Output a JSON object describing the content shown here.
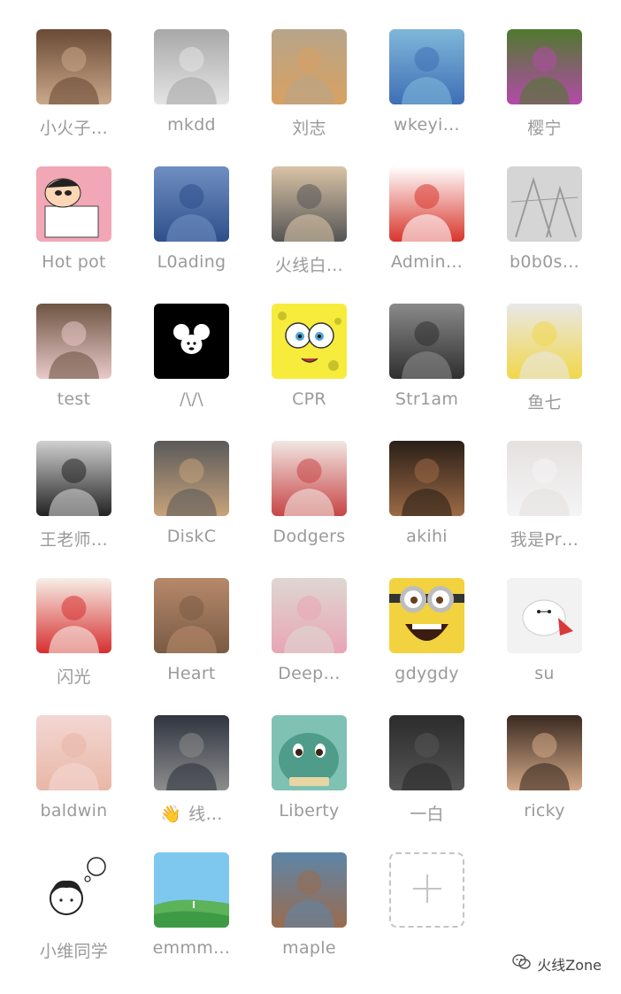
{
  "members": [
    {
      "name": "小火子…",
      "avatar_icon": "man-portrait-icon",
      "colors": [
        "#6b4a36",
        "#c9a88a"
      ]
    },
    {
      "name": "mkdd",
      "avatar_icon": "cat-toy-icon",
      "colors": [
        "#a8a8a8",
        "#e4e4e4"
      ]
    },
    {
      "name": "刘志",
      "avatar_icon": "shiba-dog-icon",
      "colors": [
        "#b7a58a",
        "#d8a162"
      ]
    },
    {
      "name": "wkeyi…",
      "avatar_icon": "stitch-cartoon-icon",
      "colors": [
        "#7fb7d9",
        "#3f6fb6"
      ]
    },
    {
      "name": "樱宁",
      "avatar_icon": "teletubby-icon",
      "colors": [
        "#4f7a2e",
        "#b34aa8"
      ]
    },
    {
      "name": "Hot pot",
      "avatar_icon": "crayon-shin-chan-icon",
      "colors": [
        "#f2a7b6",
        "#ffffff"
      ]
    },
    {
      "name": "L0ading",
      "avatar_icon": "cloaked-figure-icon",
      "colors": [
        "#6f8fc3",
        "#2e4f8a"
      ]
    },
    {
      "name": "火线白…",
      "avatar_icon": "kitten-laptop-icon",
      "colors": [
        "#d9c3a6",
        "#555555"
      ]
    },
    {
      "name": "Admin…",
      "avatar_icon": "masked-man-icon",
      "colors": [
        "#ffffff",
        "#d8352b"
      ]
    },
    {
      "name": "b0b0s…",
      "avatar_icon": "sketch-drawing-icon",
      "colors": [
        "#d5d5d5",
        "#9a9a9a"
      ]
    },
    {
      "name": "test",
      "avatar_icon": "bunny-ears-person-icon",
      "colors": [
        "#6e5543",
        "#e9c9c9"
      ]
    },
    {
      "name": "/\\/\\",
      "avatar_icon": "mickey-mouse-icon",
      "colors": [
        "#000000",
        "#ffffff"
      ]
    },
    {
      "name": "CPR",
      "avatar_icon": "spongebob-icon",
      "colors": [
        "#f7ec3c",
        "#e0a23a"
      ]
    },
    {
      "name": "Str1am",
      "avatar_icon": "two-people-photo-icon",
      "colors": [
        "#8a8a8a",
        "#2f2f2f"
      ]
    },
    {
      "name": "鱼七",
      "avatar_icon": "two-kids-snow-icon",
      "colors": [
        "#e8e8e8",
        "#f2d74a"
      ]
    },
    {
      "name": "王老师…",
      "avatar_icon": "boy-okc-shirt-icon",
      "colors": [
        "#d0d0d0",
        "#222222"
      ]
    },
    {
      "name": "DiskC",
      "avatar_icon": "cat-in-bowl-icon",
      "colors": [
        "#5a5a5a",
        "#c7a37a"
      ]
    },
    {
      "name": "Dodgers",
      "avatar_icon": "woman-red-book-icon",
      "colors": [
        "#f1e7e3",
        "#c74545"
      ]
    },
    {
      "name": "akihi",
      "avatar_icon": "curly-hair-person-icon",
      "colors": [
        "#2a1f18",
        "#9c6a45"
      ]
    },
    {
      "name": "我是Pr…",
      "avatar_icon": "white-cat-icon",
      "colors": [
        "#e6e1e1",
        "#f4f4f4"
      ]
    },
    {
      "name": "闪光",
      "avatar_icon": "anime-boy-flag-icon",
      "colors": [
        "#f7efe7",
        "#d62f2f"
      ]
    },
    {
      "name": "Heart",
      "avatar_icon": "tabby-cat-icon",
      "colors": [
        "#b6896a",
        "#7a5b44"
      ]
    },
    {
      "name": "Deep…",
      "avatar_icon": "little-girl-icon",
      "colors": [
        "#ded7d2",
        "#e9a5b5"
      ]
    },
    {
      "name": "gdygdy",
      "avatar_icon": "minion-icon",
      "colors": [
        "#f2d23e",
        "#6f6f6f"
      ]
    },
    {
      "name": "su",
      "avatar_icon": "baymax-icon",
      "colors": [
        "#f2f2f2",
        "#d83a3a"
      ]
    },
    {
      "name": "baldwin",
      "avatar_icon": "baby-bunny-hat-icon",
      "colors": [
        "#f3d7d3",
        "#e8b7a6"
      ]
    },
    {
      "name": "线…",
      "avatar_icon": "night-street-icon",
      "colors": [
        "#2f3440",
        "#8d8d8d"
      ],
      "prefix_emoji": "👋"
    },
    {
      "name": "Liberty",
      "avatar_icon": "squirtle-icon",
      "colors": [
        "#7fc2b3",
        "#4f9c8a"
      ]
    },
    {
      "name": "一白",
      "avatar_icon": "smoking-man-icon",
      "colors": [
        "#2b2b2b",
        "#555555"
      ]
    },
    {
      "name": "ricky",
      "avatar_icon": "young-man-portrait-icon",
      "colors": [
        "#3a2a20",
        "#d4a988"
      ]
    },
    {
      "name": "小维同学",
      "avatar_icon": "cartoon-boy-thought-icon",
      "colors": [
        "#ffffff",
        "#222222"
      ]
    },
    {
      "name": "emmm…",
      "avatar_icon": "green-hills-sky-icon",
      "colors": [
        "#7ec8f0",
        "#5cb35a"
      ]
    },
    {
      "name": "maple",
      "avatar_icon": "beach-person-icon",
      "colors": [
        "#5d86a8",
        "#9a6b4e"
      ]
    }
  ],
  "add_button": {
    "icon": "plus-icon"
  },
  "watermark": {
    "text": "火线Zone",
    "icon": "wechat-logo-icon"
  }
}
